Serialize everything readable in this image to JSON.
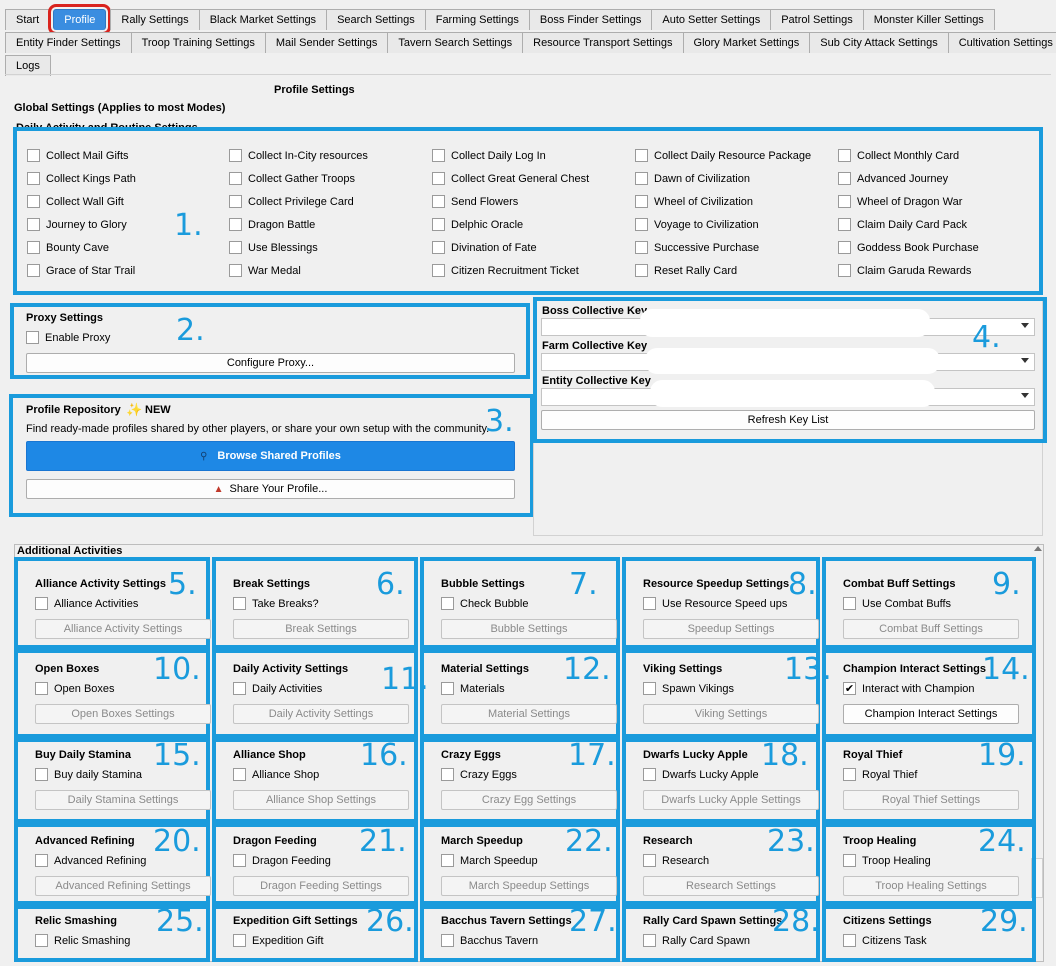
{
  "tabs_row1": [
    "Start",
    "Profile",
    "Rally Settings",
    "Black Market Settings",
    "Search Settings",
    "Farming Settings",
    "Boss Finder Settings",
    "Auto Setter Settings",
    "Patrol Settings",
    "Monster Killer Settings"
  ],
  "tabs_row2": [
    "Entity Finder Settings",
    "Troop Training Settings",
    "Mail Sender Settings",
    "Tavern Search Settings",
    "Resource Transport Settings",
    "Glory Market Settings",
    "Sub City Attack Settings",
    "Cultivation Settings"
  ],
  "tabs_row3": [
    "Logs"
  ],
  "page_title": "Profile Settings",
  "global_title": "Global Settings (Applies to most Modes)",
  "daily_title": "Daily Activity and Routine Settings",
  "daily_items": [
    [
      "Collect Mail Gifts",
      "Collect In-City resources",
      "Collect Daily Log In",
      "Collect Daily Resource Package",
      "Collect Monthly Card"
    ],
    [
      "Collect Kings Path",
      "Collect Gather Troops",
      "Collect Great General Chest",
      "Dawn of Civilization",
      "Advanced Journey"
    ],
    [
      "Collect Wall Gift",
      "Collect Privilege Card",
      "Send Flowers",
      "Wheel of Civilization",
      "Wheel of Dragon War"
    ],
    [
      "Journey to Glory",
      "Dragon Battle",
      "Delphic Oracle",
      "Voyage to Civilization",
      "Claim Daily Card Pack"
    ],
    [
      "Bounty Cave",
      "Use Blessings",
      "Divination of Fate",
      "Successive Purchase",
      "Goddess Book Purchase"
    ],
    [
      "Grace of Star Trail",
      "War Medal",
      "Citizen Recruitment Ticket",
      "Reset Rally Card",
      "Claim Garuda Rewards"
    ]
  ],
  "proxy": {
    "title": "Proxy Settings",
    "checkbox": "Enable Proxy",
    "button": "Configure Proxy..."
  },
  "repo": {
    "title": "Profile Repository",
    "badge": "NEW",
    "desc": "Find ready-made profiles shared by other players, or share your own setup with the community.",
    "browse": "Browse Shared Profiles",
    "share": "Share Your Profile..."
  },
  "keys": {
    "boss": "Boss Collective Key",
    "farm": "Farm Collective Key",
    "entity": "Entity Collective Key",
    "refresh": "Refresh Key List"
  },
  "additional_title": "Additional Activities",
  "numbers": [
    "1.",
    "2.",
    "3.",
    "4.",
    "5.",
    "6.",
    "7.",
    "8.",
    "9.",
    "10.",
    "11.",
    "12.",
    "13.",
    "14.",
    "15.",
    "16.",
    "17.",
    "18.",
    "19.",
    "20.",
    "21.",
    "22.",
    "23.",
    "24.",
    "25.",
    "26.",
    "27.",
    "28.",
    "29."
  ],
  "activities": [
    {
      "title": "Alliance Activity Settings",
      "checkbox": "Alliance Activities",
      "button": "Alliance Activity Settings",
      "checked": false,
      "enabled": false
    },
    {
      "title": "Break Settings",
      "checkbox": "Take Breaks?",
      "button": "Break Settings",
      "checked": false,
      "enabled": false
    },
    {
      "title": "Bubble Settings",
      "checkbox": "Check Bubble",
      "button": "Bubble Settings",
      "checked": false,
      "enabled": false
    },
    {
      "title": "Resource Speedup Settings",
      "checkbox": "Use Resource Speed ups",
      "button": "Speedup Settings",
      "checked": false,
      "enabled": false
    },
    {
      "title": "Combat Buff Settings",
      "checkbox": "Use Combat Buffs",
      "button": "Combat Buff Settings",
      "checked": false,
      "enabled": false
    },
    {
      "title": "Open Boxes",
      "checkbox": "Open Boxes",
      "button": "Open Boxes Settings",
      "checked": false,
      "enabled": false
    },
    {
      "title": "Daily Activity Settings",
      "checkbox": "Daily Activities",
      "button": "Daily Activity Settings",
      "checked": false,
      "enabled": false
    },
    {
      "title": "Material Settings",
      "checkbox": "Materials",
      "button": "Material Settings",
      "checked": false,
      "enabled": false
    },
    {
      "title": "Viking Settings",
      "checkbox": "Spawn Vikings",
      "button": "Viking Settings",
      "checked": false,
      "enabled": false
    },
    {
      "title": "Champion Interact Settings",
      "checkbox": "Interact with Champion",
      "button": "Champion Interact Settings",
      "checked": true,
      "enabled": true
    },
    {
      "title": "Buy Daily Stamina",
      "checkbox": "Buy daily Stamina",
      "button": "Daily Stamina Settings",
      "checked": false,
      "enabled": false
    },
    {
      "title": "Alliance Shop",
      "checkbox": "Alliance Shop",
      "button": "Alliance Shop Settings",
      "checked": false,
      "enabled": false
    },
    {
      "title": "Crazy Eggs",
      "checkbox": "Crazy Eggs",
      "button": "Crazy Egg Settings",
      "checked": false,
      "enabled": false
    },
    {
      "title": "Dwarfs Lucky Apple",
      "checkbox": "Dwarfs Lucky Apple",
      "button": "Dwarfs Lucky Apple Settings",
      "checked": false,
      "enabled": false
    },
    {
      "title": "Royal Thief",
      "checkbox": "Royal Thief",
      "button": "Royal Thief Settings",
      "checked": false,
      "enabled": false
    },
    {
      "title": "Advanced Refining",
      "checkbox": "Advanced Refining",
      "button": "Advanced Refining Settings",
      "checked": false,
      "enabled": false
    },
    {
      "title": "Dragon Feeding",
      "checkbox": "Dragon Feeding",
      "button": "Dragon Feeding Settings",
      "checked": false,
      "enabled": false
    },
    {
      "title": "March Speedup",
      "checkbox": "March Speedup",
      "button": "March Speedup Settings",
      "checked": false,
      "enabled": false
    },
    {
      "title": "Research",
      "checkbox": "Research",
      "button": "Research Settings",
      "checked": false,
      "enabled": false
    },
    {
      "title": "Troop Healing",
      "checkbox": "Troop Healing",
      "button": "Troop Healing Settings",
      "checked": false,
      "enabled": false
    },
    {
      "title": "Relic Smashing",
      "checkbox": "Relic Smashing",
      "button": "",
      "checked": false,
      "enabled": false
    },
    {
      "title": "Expedition Gift Settings",
      "checkbox": "Expedition Gift",
      "button": "",
      "checked": false,
      "enabled": false
    },
    {
      "title": "Bacchus Tavern Settings",
      "checkbox": "Bacchus Tavern",
      "button": "",
      "checked": false,
      "enabled": false
    },
    {
      "title": "Rally Card Spawn Settings",
      "checkbox": "Rally Card Spawn",
      "button": "",
      "checked": false,
      "enabled": false
    },
    {
      "title": "Citizens Settings",
      "checkbox": "Citizens Task",
      "button": "",
      "checked": false,
      "enabled": false
    }
  ],
  "colors": {
    "annotation": "#1a9bdc",
    "active_tab": "#3a8de0",
    "highlight": "#d9231d",
    "primary_button": "#1e88e5"
  }
}
